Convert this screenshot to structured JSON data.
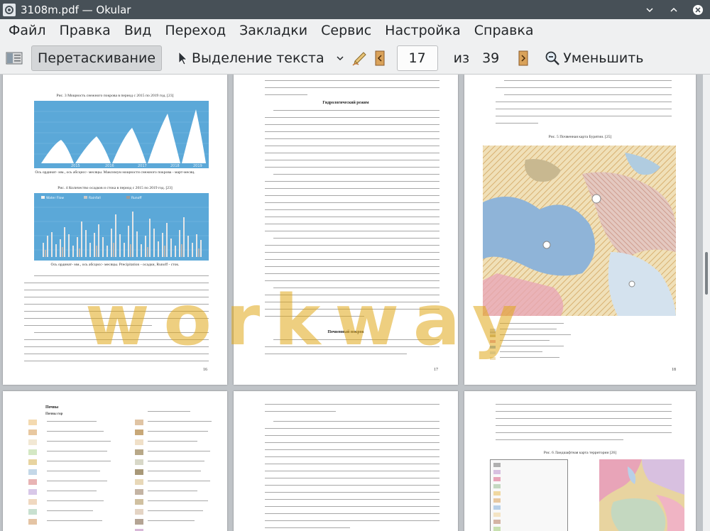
{
  "window": {
    "title": "3108m.pdf — Okular",
    "title_color": "#475057"
  },
  "menubar": {
    "items": [
      "Файл",
      "Правка",
      "Вид",
      "Переход",
      "Закладки",
      "Сервис",
      "Настройка",
      "Справка"
    ]
  },
  "toolbar": {
    "browse_label": "Перетаскивание",
    "text_select_label": "Выделение текста",
    "current_page": "17",
    "of_label": "из",
    "total_pages": "39",
    "zoom_out_label": "Уменьшить"
  },
  "pages": {
    "p16": {
      "fig3_caption": "Рис. 3 Мощность снежного покрова в период с 2015 по 2019 год. [23]",
      "fig3_axis_note": "Ось ординат- мм., ось абсцисс- месяцы. Максимум мощности снежного покрова - март-месяц.",
      "fig4_caption": "Рис. 4 Количество осадков и стока в период с 2015 по 2019 год. [23]",
      "fig4_axis_note": "Ось ординат- мм., ось абсцисс- месяцы. Precipitation - осадки, Runoff - сток.",
      "legend": [
        "Water Flow",
        "Rainfall",
        "Runoff"
      ],
      "page_number": "16",
      "chart_labels": [
        "2015",
        "2016",
        "2017",
        "2018",
        "2019"
      ]
    },
    "p17": {
      "heading1": "Гидрологический режим",
      "heading2": "Почвенный покров",
      "page_number": "17"
    },
    "p18": {
      "fig5_caption": "Рис. 5 Почвенная карта Бурятии. [25]",
      "page_number": "18"
    },
    "p19": {
      "legend_title": "Почвы",
      "sub_title": "Почвы гор"
    },
    "p20": {},
    "p21": {
      "fig6_caption": "Рис. 6 Ландшафтная карта территории [26]"
    }
  },
  "watermark": {
    "text": "workway",
    "color": "#e0a818"
  },
  "colors": {
    "chart_blue": "#5ba8d8",
    "map_beige": "#e8d4a0",
    "map_blue": "#8fb4d8",
    "map_pink": "#e8a4b8"
  }
}
